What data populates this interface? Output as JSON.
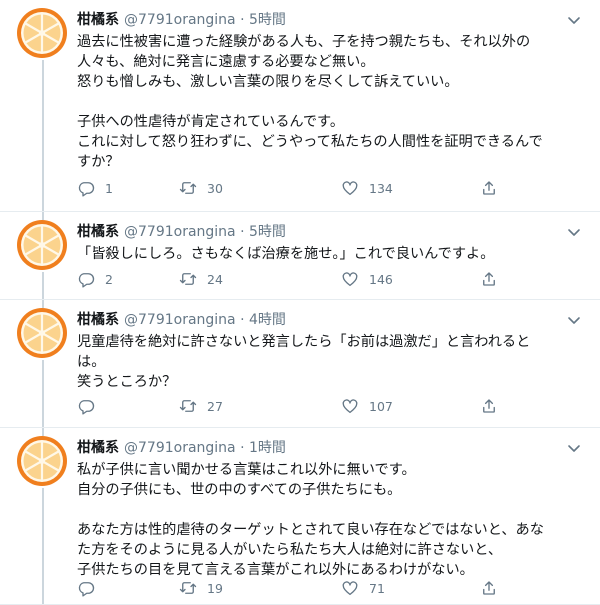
{
  "user": {
    "name": "柑橘系",
    "handle": "@7791orangina",
    "dot": "·"
  },
  "tweets": [
    {
      "time": "5時間",
      "lines": [
        "過去に性被害に遭った経験がある人も、子を持つ親たちも、それ以外の",
        "人々も、絶対に発言に遠慮する必要など無い。",
        "怒りも憎しみも、激しい言葉の限りを尽くして訴えていい。",
        "",
        "子供への性虐待が肯定されているんです。",
        "これに対して怒り狂わずに、どうやって私たちの人間性を証明できるんで",
        "すか？"
      ],
      "replies": "1",
      "retweets": "30",
      "likes": "134"
    },
    {
      "time": "5時間",
      "lines": [
        "「皆殺しにしろ。さもなくば治療を施せ。」これで良いんですよ。"
      ],
      "replies": "2",
      "retweets": "24",
      "likes": "146"
    },
    {
      "time": "4時間",
      "lines": [
        "児童虐待を絶対に許さないと発言したら「お前は過激だ」と言われると",
        "は。",
        "笑うところか？"
      ],
      "replies": "",
      "retweets": "27",
      "likes": "107"
    },
    {
      "time": "1時間",
      "lines": [
        "私が子供に言い聞かせる言葉はこれ以外に無いです。",
        "自分の子供にも、世の中のすべての子供たちにも。",
        "",
        "あなた方は性的虐待のターゲットとされて良い存在などではないと、あな",
        "た方をそのように見る人がいたら私たち大人は絶対に許さないと、",
        "子供たちの目を見て言える言葉がこれ以外にあるわけがない。"
      ],
      "replies": "",
      "retweets": "19",
      "likes": "71"
    }
  ],
  "icons": {
    "avatar": "orange-slice-avatar",
    "caret": "chevron-down-icon",
    "reply": "reply-icon",
    "retweet": "retweet-icon",
    "like": "heart-icon",
    "share": "share-icon"
  },
  "colors": {
    "text": "#14171a",
    "muted": "#657786",
    "divider": "#e6ecf0",
    "thread": "#ccd6dd",
    "avatar_ring": "#f07f1e",
    "avatar_fill": "#fbd38d"
  }
}
